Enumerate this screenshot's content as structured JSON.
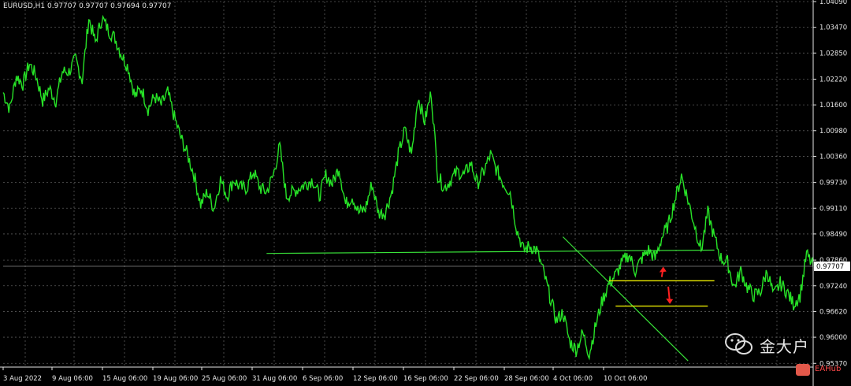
{
  "header": {
    "symbol": "EURUSD,H1",
    "ohlc": "0.97707 0.97707 0.97694 0.97707"
  },
  "current_price_label": "0.97707",
  "watermark": {
    "text": "金大户",
    "brand": "EAHub"
  },
  "colors": {
    "background": "#000000",
    "price": "#27e327",
    "grid": "#5a5a5a",
    "axis_text": "#e6e6e6",
    "trendline": "#39e339",
    "hline": "#e6e600",
    "arrow": "#ff2020"
  },
  "chart_data": {
    "type": "line",
    "ylim": [
      0.9528,
      1.0409
    ],
    "y_ticks": [
      "1.04090",
      "1.03470",
      "1.02850",
      "1.02220",
      "1.01600",
      "1.00980",
      "1.00360",
      "0.99730",
      "0.99110",
      "0.98490",
      "0.97860",
      "0.97240",
      "0.96620",
      "0.96000",
      "0.95370"
    ],
    "y_tick_values": [
      1.0409,
      1.0347,
      1.0285,
      1.0222,
      1.016,
      1.0098,
      1.0036,
      0.9973,
      0.9911,
      0.9849,
      0.9786,
      0.9724,
      0.9662,
      0.96,
      0.9537
    ],
    "x_ticks": [
      "3 Aug 2022",
      "9 Aug 06:00",
      "15 Aug 06:00",
      "19 Aug 06:00",
      "25 Aug 06:00",
      "31 Aug 06:00",
      "6 Sep 06:00",
      "12 Sep 06:00",
      "16 Sep 06:00",
      "22 Sep 06:00",
      "28 Sep 06:00",
      "4 Oct 06:00",
      "10 Oct 06:00"
    ],
    "series": [
      {
        "values": [
          1.019,
          1.015,
          1.023,
          1.021,
          1.026,
          1.023,
          1.017,
          1.02,
          1.017,
          1.024,
          1.024,
          1.027,
          1.022,
          1.037,
          1.031,
          1.037,
          1.034,
          1.032,
          1.028,
          1.025,
          1.018,
          1.02,
          1.015,
          1.018,
          1.016,
          1.019,
          1.013,
          1.008,
          1.004,
          0.999,
          0.992,
          0.995,
          0.991,
          0.998,
          0.994,
          0.998,
          0.996,
          0.996,
          1.0,
          0.996,
          0.995,
          0.999,
          1.006,
          0.994,
          0.995,
          0.996,
          0.997,
          0.998,
          0.994,
          0.999,
          0.997,
          1.001,
          0.992,
          0.994,
          0.99,
          0.991,
          0.997,
          0.99,
          0.99,
          0.995,
          1.004,
          1.01,
          1.004,
          1.018,
          1.012,
          1.019,
          0.999,
          0.996,
          0.998,
          1.0,
          0.999,
          1.002,
          0.997,
          1.0,
          1.004,
          1.0,
          0.997,
          0.995,
          0.986,
          0.981,
          0.982,
          0.981,
          0.976,
          0.97,
          0.964,
          0.966,
          0.959,
          0.957,
          0.961,
          0.956,
          0.963,
          0.969,
          0.973,
          0.975,
          0.978,
          0.98,
          0.976,
          0.979,
          0.981,
          0.979,
          0.984,
          0.987,
          0.993,
          0.999,
          0.993,
          0.987,
          0.981,
          0.99,
          0.984,
          0.979,
          0.978,
          0.972,
          0.976,
          0.972,
          0.97,
          0.971,
          0.976,
          0.97,
          0.973,
          0.971,
          0.968,
          0.97,
          0.98,
          0.9771
        ]
      }
    ],
    "trendlines": [
      {
        "from": [
          40,
          0.9802
        ],
        "to": [
          108,
          0.981
        ]
      },
      {
        "from": [
          85,
          0.9842
        ],
        "to": [
          104,
          0.9543
        ]
      }
    ],
    "hlines": [
      {
        "from": 92,
        "to": 108,
        "y": 0.9736
      },
      {
        "from": 93,
        "to": 107,
        "y": 0.9675
      }
    ],
    "arrows": [
      {
        "x": 100,
        "from": 0.9745,
        "to": 0.9768
      },
      {
        "x": 101,
        "from": 0.9722,
        "to": 0.9682
      }
    ]
  }
}
